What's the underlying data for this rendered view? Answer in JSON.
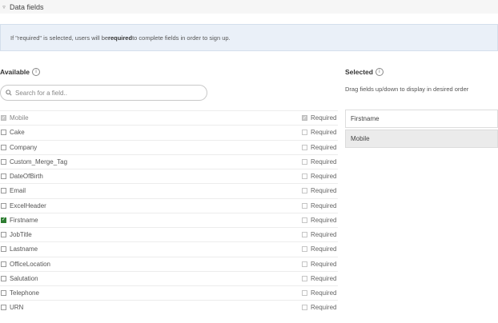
{
  "section": {
    "title": "Data fields",
    "chevron_icon": "chevron-down-icon"
  },
  "notice": {
    "prefix": "If \"required\" is selected, users will be ",
    "bold": "required",
    "suffix": " to complete fields in order to sign up."
  },
  "available": {
    "title": "Available",
    "info_symbol": "i",
    "search_placeholder": "Search for a field..",
    "search_icon": "search-icon",
    "fields": [
      {
        "name": "Mobile",
        "checked": true,
        "disabled": true,
        "required_label": "Required",
        "required_checked": true,
        "required_disabled": true
      },
      {
        "name": "Cake",
        "checked": false,
        "required_label": "Required",
        "required_checked": false
      },
      {
        "name": "Company",
        "checked": false,
        "required_label": "Required",
        "required_checked": false
      },
      {
        "name": "Custom_Merge_Tag",
        "checked": false,
        "required_label": "Required",
        "required_checked": false
      },
      {
        "name": "DateOfBirth",
        "checked": false,
        "required_label": "Required",
        "required_checked": false
      },
      {
        "name": "Email",
        "checked": false,
        "required_label": "Required",
        "required_checked": false
      },
      {
        "name": "ExcelHeader",
        "checked": false,
        "required_label": "Required",
        "required_checked": false
      },
      {
        "name": "Firstname",
        "checked": true,
        "required_label": "Required",
        "required_checked": false
      },
      {
        "name": "JobTitle",
        "checked": false,
        "required_label": "Required",
        "required_checked": false
      },
      {
        "name": "Lastname",
        "checked": false,
        "required_label": "Required",
        "required_checked": false
      },
      {
        "name": "OfficeLocation",
        "checked": false,
        "required_label": "Required",
        "required_checked": false
      },
      {
        "name": "Salutation",
        "checked": false,
        "required_label": "Required",
        "required_checked": false
      },
      {
        "name": "Telephone",
        "checked": false,
        "required_label": "Required",
        "required_checked": false
      },
      {
        "name": "URN",
        "checked": false,
        "required_label": "Required",
        "required_checked": false
      }
    ]
  },
  "selected": {
    "title": "Selected",
    "info_symbol": "i",
    "subtitle": "Drag fields up/down to display in desired order",
    "items": [
      "Firstname",
      "Mobile"
    ]
  }
}
